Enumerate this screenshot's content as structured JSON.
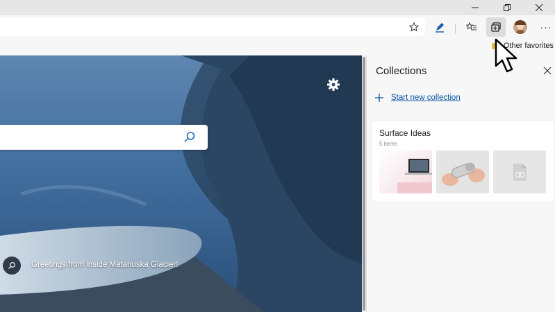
{
  "window_controls": [
    "minimize-icon",
    "restore-icon",
    "close-icon"
  ],
  "toolbar": {
    "icons": [
      "star-icon",
      "pen-icon",
      "favorites-list-icon",
      "collections-icon",
      "avatar",
      "more-icon"
    ],
    "more_label": "···"
  },
  "favorites_bar": {
    "other_favorites": "Other favorites"
  },
  "new_tab": {
    "greeting": "Greetings from inside Matanuska Glacier!"
  },
  "collections": {
    "title": "Collections",
    "start_new": "Start new collection",
    "cards": [
      {
        "title": "Surface Ideas",
        "count": "5 items"
      }
    ]
  },
  "colors": {
    "accent": "#0a57a8",
    "titlebar": "#e6e6e6",
    "pane_bg": "#f7f7f7"
  }
}
